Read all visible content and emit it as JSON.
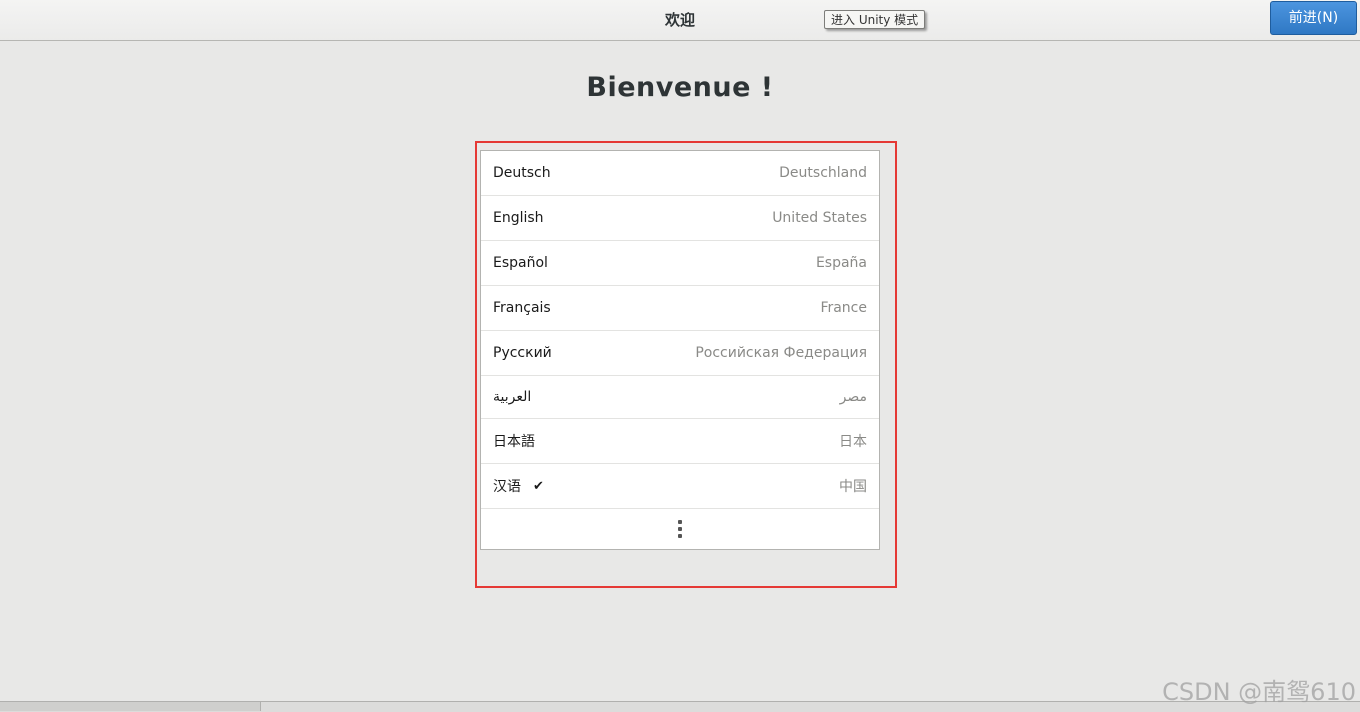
{
  "header": {
    "title": "欢迎",
    "tooltip": "进入 Unity 模式",
    "next_button": "前进(N)"
  },
  "main": {
    "title": "Bienvenue !"
  },
  "languages": [
    {
      "name": "Deutsch",
      "region": "Deutschland",
      "selected": false
    },
    {
      "name": "English",
      "region": "United States",
      "selected": false
    },
    {
      "name": "Español",
      "region": "España",
      "selected": false
    },
    {
      "name": "Français",
      "region": "France",
      "selected": false
    },
    {
      "name": "Русский",
      "region": "Российская Федерация",
      "selected": false
    },
    {
      "name": "العربية",
      "region": "مصر",
      "selected": false
    },
    {
      "name": "日本語",
      "region": "日本",
      "selected": false
    },
    {
      "name": "汉语",
      "region": "中国",
      "selected": true
    }
  ],
  "icons": {
    "selected": "checkmark-icon",
    "more": "vertical-ellipsis-icon",
    "check_glyph": "✔"
  },
  "colors": {
    "accent": "#3584e4",
    "highlight_border": "#e53935"
  },
  "watermark": "CSDN @南鸳610"
}
